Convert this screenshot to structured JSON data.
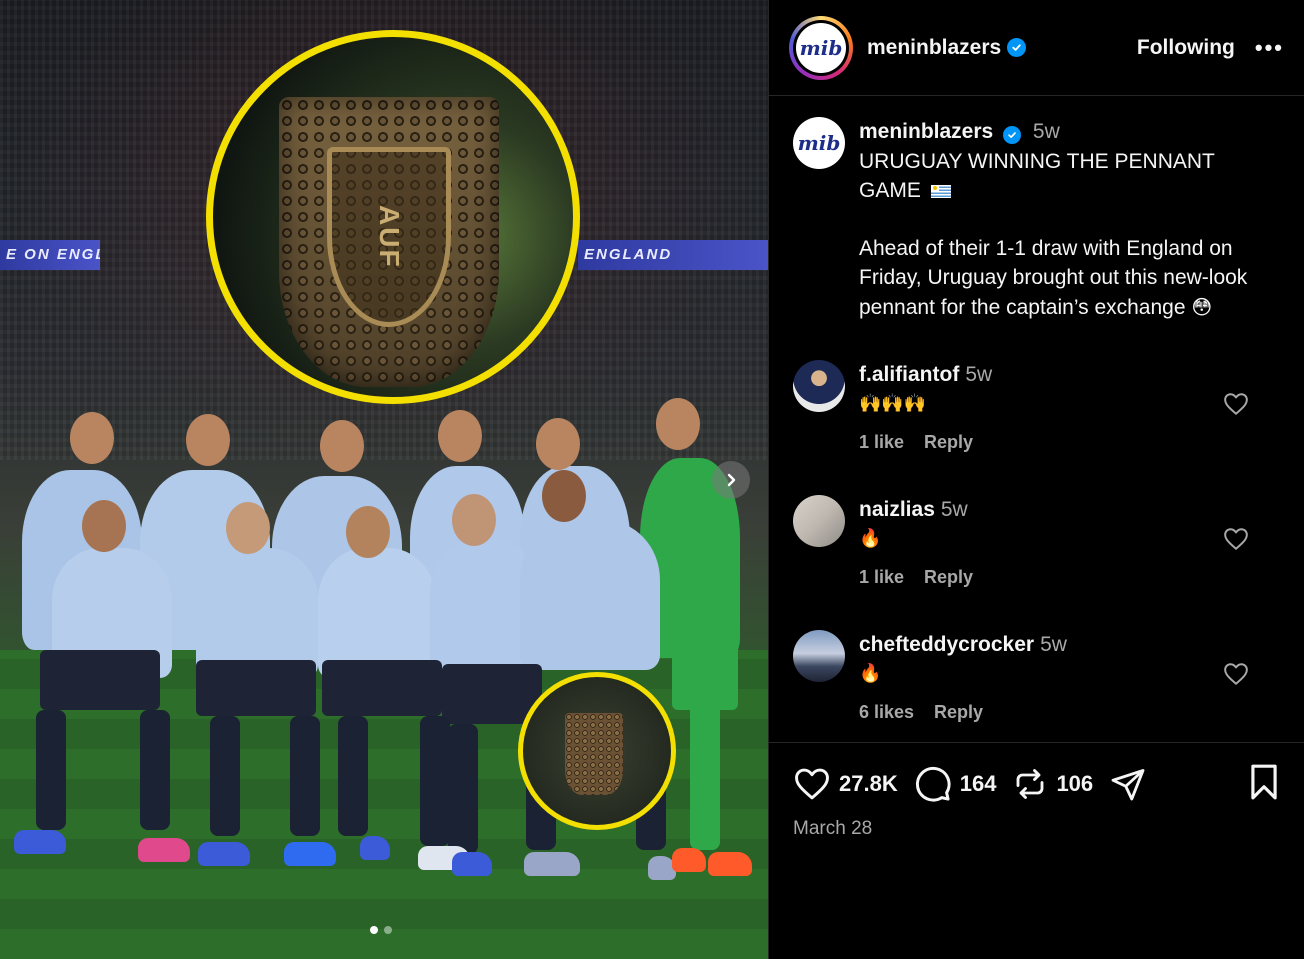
{
  "photo": {
    "banner_left": "E ON ENGLAND",
    "banner_right": "ENGLAND",
    "pennant_letters": "AUF",
    "carousel_dots": 2,
    "active_dot": 0
  },
  "header": {
    "avatar_text": "mib",
    "username": "meninblazers",
    "following_label": "Following",
    "more_label": "•••"
  },
  "caption": {
    "avatar_text": "mib",
    "username": "meninblazers",
    "time": "5w",
    "line1": "URUGUAY WINNING THE PENNANT GAME",
    "body": "Ahead of their 1-1 draw with England on Friday, Uruguay brought out this new-look pennant for the captain’s exchange",
    "body_emoji": "😳"
  },
  "comments": [
    {
      "username": "f.alifiantof",
      "time": "5w",
      "text": "🙌🙌🙌",
      "likes": "1 like",
      "reply": "Reply"
    },
    {
      "username": "naizlias",
      "time": "5w",
      "text": "🔥",
      "likes": "1 like",
      "reply": "Reply"
    },
    {
      "username": "chefteddycrocker",
      "time": "5w",
      "text": "🔥",
      "likes": "6 likes",
      "reply": "Reply"
    }
  ],
  "actions": {
    "likes": "27.8K",
    "comments": "164",
    "reposts": "106",
    "date": "March 28"
  },
  "colors": {
    "highlight_circle": "#f4e000",
    "verified": "#0095f6",
    "muted_text": "#a8a8a8"
  }
}
